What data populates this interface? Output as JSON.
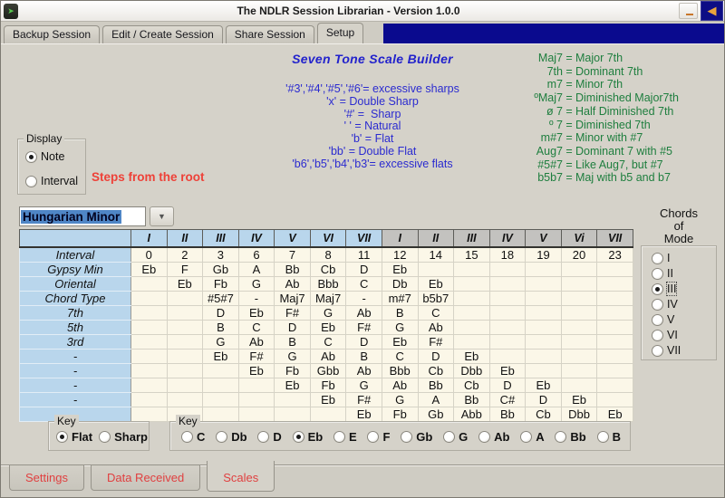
{
  "window": {
    "title": "The NDLR Session Librarian - Version 1.0.0",
    "app_icon_glyph": "➤",
    "controls": {
      "back_arrow": "◀"
    }
  },
  "colors": {
    "navy_band": "#0a0a8e",
    "title_blue": "#2222cc",
    "legend_blue": "#2b2bd0",
    "legend_green": "#1e7e3e",
    "accent_red": "#ee4138",
    "table_green": "#1e9e4c",
    "table_red": "#e02222",
    "table_blue": "#2222cc",
    "label_col_bg": "#b9d6ec",
    "header_gray_bg": "#c3c2bf",
    "cell_bg": "#fbf7e8",
    "select_highlight": "#4f86c6"
  },
  "top_tabs": [
    {
      "label": "Backup Session",
      "active": false
    },
    {
      "label": "Edit / Create Session",
      "active": false
    },
    {
      "label": "Share Session",
      "active": false
    },
    {
      "label": "Setup",
      "active": true
    }
  ],
  "main": {
    "title": "Seven Tone Scale Builder",
    "steps_label": "Steps from the root"
  },
  "legend_blue": [
    "'#3','#4','#5','#6'= excessive sharps",
    "'x' = Double Sharp",
    "'#' =  Sharp",
    "' ' = Natural",
    "'b' = Flat",
    "'bb' = Double Flat",
    "'b6','b5','b4','b3'= excessive flats"
  ],
  "legend_green": [
    {
      "k": "Maj7",
      "v": "Major 7th"
    },
    {
      "k": "7th",
      "v": "Dominant 7th"
    },
    {
      "k": "m7",
      "v": "Minor 7th"
    },
    {
      "k": "ºMaj7",
      "v": "Diminished Major7th"
    },
    {
      "k": "ø 7",
      "v": "Half Diminished 7th"
    },
    {
      "k": "º 7",
      "v": "Diminished 7th"
    },
    {
      "k": "m#7",
      "v": "Minor with #7"
    },
    {
      "k": "Aug7",
      "v": "Dominant 7 with #5"
    },
    {
      "k": "#5#7",
      "v": "Like Aug7, but #7"
    },
    {
      "k": "b5b7",
      "v": "Maj with b5 and b7"
    }
  ],
  "display_group": {
    "legend": "Display",
    "options": [
      {
        "label": "Note",
        "selected": true
      },
      {
        "label": "Interval",
        "selected": false
      }
    ]
  },
  "scale_select": {
    "value": "Hungarian Minor",
    "arrow": "▼"
  },
  "table": {
    "col_headers": [
      {
        "label": "I",
        "g": "blue"
      },
      {
        "label": "II",
        "g": "blue"
      },
      {
        "label": "III",
        "g": "blue"
      },
      {
        "label": "IV",
        "g": "blue"
      },
      {
        "label": "V",
        "g": "blue"
      },
      {
        "label": "VI",
        "g": "blue"
      },
      {
        "label": "VII",
        "g": "blue"
      },
      {
        "label": "I",
        "g": "gray"
      },
      {
        "label": "II",
        "g": "gray"
      },
      {
        "label": "III",
        "g": "gray"
      },
      {
        "label": "IV",
        "g": "gray"
      },
      {
        "label": "V",
        "g": "gray"
      },
      {
        "label": "Vi",
        "g": "gray"
      },
      {
        "label": "VII",
        "g": "gray"
      }
    ],
    "rows": [
      {
        "label": "Interval",
        "lc": "black",
        "dc": "black",
        "cells": [
          "0",
          "2",
          "3",
          "6",
          "7",
          "8",
          "11",
          "12",
          "14",
          "15",
          "18",
          "19",
          "20",
          "23"
        ]
      },
      {
        "label": "Gypsy Min",
        "lc": "black",
        "dc": "black",
        "cells": [
          "Eb",
          "F",
          "Gb",
          "A",
          "Bb",
          "Cb",
          "D",
          "Eb",
          "",
          "",
          "",
          "",
          "",
          ""
        ]
      },
      {
        "label": "Oriental",
        "lc": "black",
        "dc": "black",
        "cells": [
          "",
          "Eb",
          "Fb",
          "G",
          "Ab",
          "Bbb",
          "C",
          "Db",
          "Eb",
          "",
          "",
          "",
          "",
          ""
        ]
      },
      {
        "label": "Chord Type",
        "lc": "green",
        "dc": "green",
        "cells": [
          "",
          "",
          "#5#7",
          "-",
          "Maj7",
          "Maj7",
          "-",
          "m#7",
          "b5b7",
          "",
          "",
          "",
          "",
          ""
        ]
      },
      {
        "label": "7th",
        "lc": "red",
        "dc": "red",
        "cells": [
          "",
          "",
          "D",
          "Eb",
          "F#",
          "G",
          "Ab",
          "B",
          "C",
          "",
          "",
          "",
          "",
          ""
        ]
      },
      {
        "label": "5th",
        "lc": "red",
        "dc": "red",
        "cells": [
          "",
          "",
          "B",
          "C",
          "D",
          "Eb",
          "F#",
          "G",
          "Ab",
          "",
          "",
          "",
          "",
          ""
        ]
      },
      {
        "label": "3rd",
        "lc": "red",
        "dc": "red",
        "cells": [
          "",
          "",
          "G",
          "Ab",
          "B",
          "C",
          "D",
          "Eb",
          "F#",
          "",
          "",
          "",
          "",
          ""
        ]
      },
      {
        "label": "-",
        "lc": "black",
        "dc": "blue",
        "cells": [
          "",
          "",
          "Eb",
          "F#",
          "G",
          "Ab",
          "B",
          "C",
          "D",
          "Eb",
          "",
          "",
          "",
          ""
        ]
      },
      {
        "label": "-",
        "lc": "black",
        "dc": "black",
        "cells": [
          "",
          "",
          "",
          "Eb",
          "Fb",
          "Gbb",
          "Ab",
          "Bbb",
          "Cb",
          "Dbb",
          "Eb",
          "",
          "",
          ""
        ]
      },
      {
        "label": "-",
        "lc": "black",
        "dc": "black",
        "cells": [
          "",
          "",
          "",
          "",
          "Eb",
          "Fb",
          "G",
          "Ab",
          "Bb",
          "Cb",
          "D",
          "Eb",
          "",
          ""
        ]
      },
      {
        "label": "-",
        "lc": "black",
        "dc": "black",
        "cells": [
          "",
          "",
          "",
          "",
          "",
          "Eb",
          "F#",
          "G",
          "A",
          "Bb",
          "C#",
          "D",
          "Eb",
          ""
        ]
      },
      {
        "label": "-",
        "lc": "black",
        "dc": "black",
        "cells": [
          "",
          "",
          "",
          "",
          "",
          "",
          "Eb",
          "Fb",
          "Gb",
          "Abb",
          "Bb",
          "Cb",
          "Dbb",
          "Eb"
        ]
      }
    ]
  },
  "chords_panel": {
    "title_lines": [
      "Chords",
      "of",
      "Mode"
    ],
    "options": [
      {
        "label": "I"
      },
      {
        "label": "II"
      },
      {
        "label": "III",
        "selected": true,
        "focused": true
      },
      {
        "label": "IV"
      },
      {
        "label": "V"
      },
      {
        "label": "VI"
      },
      {
        "label": "VII"
      }
    ]
  },
  "key_groups": [
    {
      "legend": "Key",
      "options": [
        {
          "label": "Flat",
          "selected": true
        },
        {
          "label": "Sharp"
        }
      ]
    },
    {
      "legend": "Key",
      "options": [
        {
          "label": "C"
        },
        {
          "label": "Db"
        },
        {
          "label": "D"
        },
        {
          "label": "Eb",
          "selected": true
        },
        {
          "label": "E"
        },
        {
          "label": "F"
        },
        {
          "label": "Gb"
        },
        {
          "label": "G"
        },
        {
          "label": "Ab"
        },
        {
          "label": "A"
        },
        {
          "label": "Bb"
        },
        {
          "label": "B"
        }
      ]
    }
  ],
  "bottom_tabs": [
    {
      "label": "Settings",
      "active": false
    },
    {
      "label": "Data Received",
      "active": false
    },
    {
      "label": "Scales",
      "active": true
    }
  ]
}
